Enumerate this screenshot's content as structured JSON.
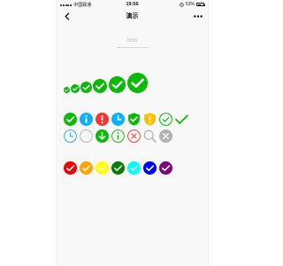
{
  "status_bar": {
    "carrier": "中国联通",
    "network": "",
    "time": "19:56",
    "battery_percent": "53%",
    "battery_level": 0.53
  },
  "nav": {
    "title": "演示",
    "back_icon": "chevron-left-icon",
    "more_icon": "more-dots-icon"
  },
  "section": {
    "label": "icon"
  },
  "colors": {
    "green": "#09bb07",
    "blue": "#10aeff",
    "red": "#f43530",
    "orange": "#ffbe00",
    "gray": "#b2b2b2",
    "palette": [
      "#f00000",
      "#ffa500",
      "#ffff00",
      "#008000",
      "#00ffff",
      "#0000ff",
      "#800080"
    ]
  },
  "icon_rows": {
    "sizes_row": [
      "success-icon",
      "success-icon",
      "success-icon",
      "success-icon",
      "success-icon",
      "success-icon"
    ],
    "types_row_1": [
      "success-icon",
      "info-icon",
      "warn-icon",
      "waiting-icon",
      "safe-success-icon",
      "safe-warn-icon",
      "success-circle-icon",
      "success-no-circle-icon"
    ],
    "types_row_2": [
      "waiting-circle-icon",
      "circle-icon",
      "download-icon",
      "info-circle-icon",
      "cancel-icon",
      "search-icon",
      "clear-icon"
    ],
    "colors_row": [
      "success-icon",
      "success-icon",
      "success-icon",
      "success-icon",
      "success-icon",
      "success-icon",
      "success-icon"
    ]
  }
}
